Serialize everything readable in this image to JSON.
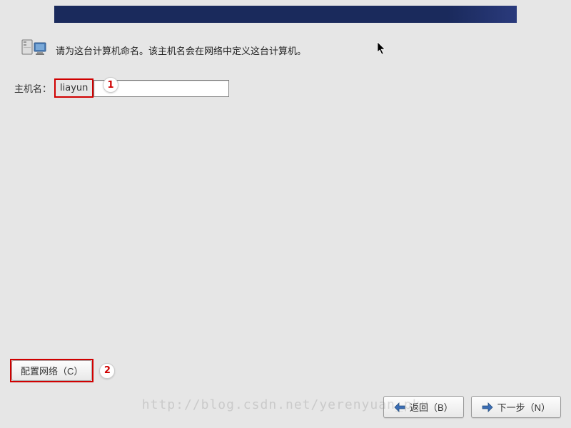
{
  "banner": {},
  "instruction": {
    "text": "请为这台计算机命名。该主机名会在网络中定义这台计算机。"
  },
  "hostname": {
    "label": "主机名：",
    "value": "liayun"
  },
  "callouts": {
    "one": "1",
    "two": "2"
  },
  "network_button": {
    "label": "配置网络（C）"
  },
  "footer": {
    "back_label": "返回（B）",
    "next_label": "下一步（N）"
  },
  "watermark": "http://blog.csdn.net/yerenyuan_pku"
}
